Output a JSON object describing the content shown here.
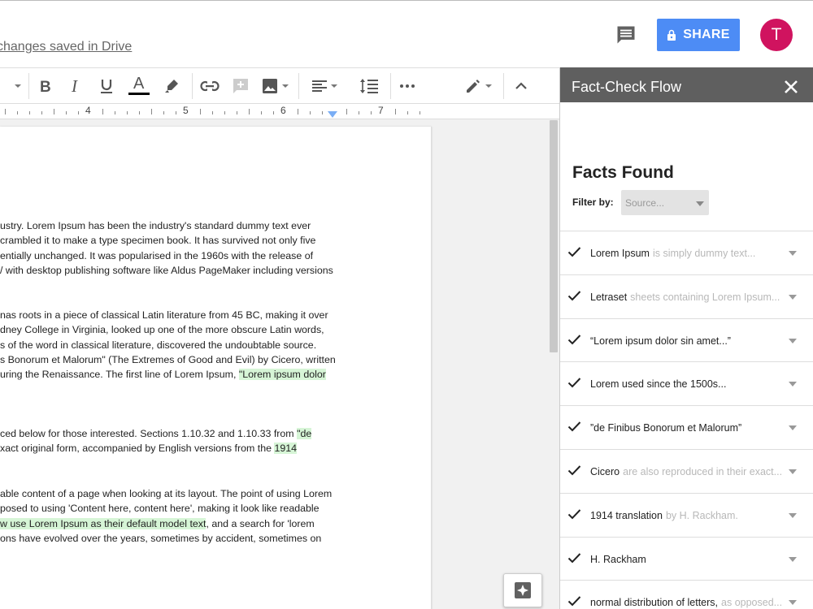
{
  "header": {
    "saved_text": "changes saved in Drive",
    "share_label": "SHARE",
    "avatar_initial": "T",
    "colors": {
      "share": "#4d8cf5",
      "avatar": "#d0135f"
    }
  },
  "toolbar": {
    "items": [
      "font-size-dropdown",
      "bold",
      "italic",
      "underline",
      "text-color",
      "highlight-color",
      "insert-link",
      "add-comment",
      "insert-image",
      "align",
      "line-spacing",
      "more",
      "editing-mode",
      "collapse"
    ]
  },
  "ruler": {
    "numbers": [
      "4",
      "5",
      "6",
      "7"
    ]
  },
  "document": {
    "paragraphs": [
      {
        "lines": [
          [
            {
              "t": "ustry. Lorem Ipsum has been the industry's standard dummy text ever"
            }
          ],
          [
            {
              "t": "crambled it to make a type specimen book. It has survived not only five"
            }
          ],
          [
            {
              "t": "entially unchanged. It was popularised in the 1960s with the release of"
            }
          ],
          [
            {
              "t": "/ with desktop publishing software like Aldus PageMaker including versions"
            }
          ]
        ]
      },
      {
        "lines": [
          [
            {
              "t": "nas roots in a piece of classical Latin literature from 45 BC, making it over"
            }
          ],
          [
            {
              "t": "dney College in Virginia, looked up one of the more obscure Latin words,"
            }
          ],
          [
            {
              "t": "s of the word in classical literature, discovered the undoubtable source."
            }
          ],
          [
            {
              "t": "s Bonorum et Malorum\" (The Extremes of Good and Evil) by Cicero, written"
            }
          ],
          [
            {
              "t": "uring the Renaissance. The first line of Lorem Ipsum, "
            },
            {
              "t": "\"Lorem ipsum dolor",
              "h": true
            }
          ]
        ]
      },
      {
        "lines": [
          [
            {
              "t": "ced below for those interested. Sections 1.10.32 and 1.10.33 from "
            },
            {
              "t": "\"de",
              "h": true
            }
          ],
          [
            {
              "t": "xact original form, accompanied by English versions from the "
            },
            {
              "t": "1914",
              "h": true
            }
          ]
        ]
      },
      {
        "lines": [
          [
            {
              "t": "able content of a page when looking at its layout. The point of using Lorem"
            }
          ],
          [
            {
              "t": "posed to using 'Content here, content here', making it look like readable"
            }
          ],
          [
            {
              "t": "w use Lorem Ipsum as their default model text",
              "h": true
            },
            {
              "t": ", and a search for 'lorem"
            }
          ],
          [
            {
              "t": "ons have evolved over the years, sometimes by accident, sometimes on"
            }
          ]
        ]
      }
    ],
    "highlight_color": "#d6f5d6"
  },
  "panel": {
    "title": "Fact-Check Flow",
    "heading": "Facts Found",
    "filter_label": "Filter by:",
    "filter_placeholder": "Source...",
    "facts": [
      {
        "main": "Lorem Ipsum",
        "sub": "is simply dummy text..."
      },
      {
        "main": "Letraset",
        "sub": "sheets containing Lorem Ipsum..."
      },
      {
        "main": "“Lorem ipsum dolor sin amet...”",
        "sub": ""
      },
      {
        "main": "Lorem used since the 1500s...",
        "sub": ""
      },
      {
        "main": "”de Finibus Bonorum et Malorum”",
        "sub": ""
      },
      {
        "main": "Cicero",
        "sub": "are also reproduced in their exact..."
      },
      {
        "main": "1914 translation",
        "sub": "by H. Rackham."
      },
      {
        "main": "H. Rackham",
        "sub": ""
      },
      {
        "main": "normal distribution of letters,",
        "sub": "as opposed..."
      }
    ]
  }
}
